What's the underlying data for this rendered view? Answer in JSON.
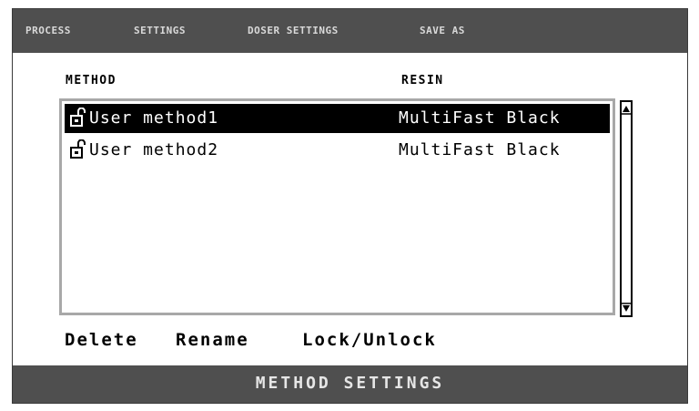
{
  "menu": {
    "tabs": [
      {
        "label": "PROCESS"
      },
      {
        "label": "SETTINGS"
      },
      {
        "label": "DOSER SETTINGS"
      },
      {
        "label": "SAVE AS"
      }
    ]
  },
  "table": {
    "headers": {
      "method": "METHOD",
      "resin": "RESIN"
    },
    "rows": [
      {
        "method": "User method1",
        "resin": "MultiFast Black",
        "selected": true,
        "icon": "unlocked-lock-icon"
      },
      {
        "method": "User method2",
        "resin": "MultiFast Black",
        "selected": false,
        "icon": "unlocked-lock-icon"
      }
    ]
  },
  "actions": {
    "delete": "Delete",
    "rename": "Rename",
    "lock_unlock": "Lock/Unlock"
  },
  "footer": {
    "title": "METHOD SETTINGS"
  },
  "colors": {
    "bar": "#4f4f4f",
    "list_border": "#a8a8a8",
    "selected_bg": "#000000"
  }
}
